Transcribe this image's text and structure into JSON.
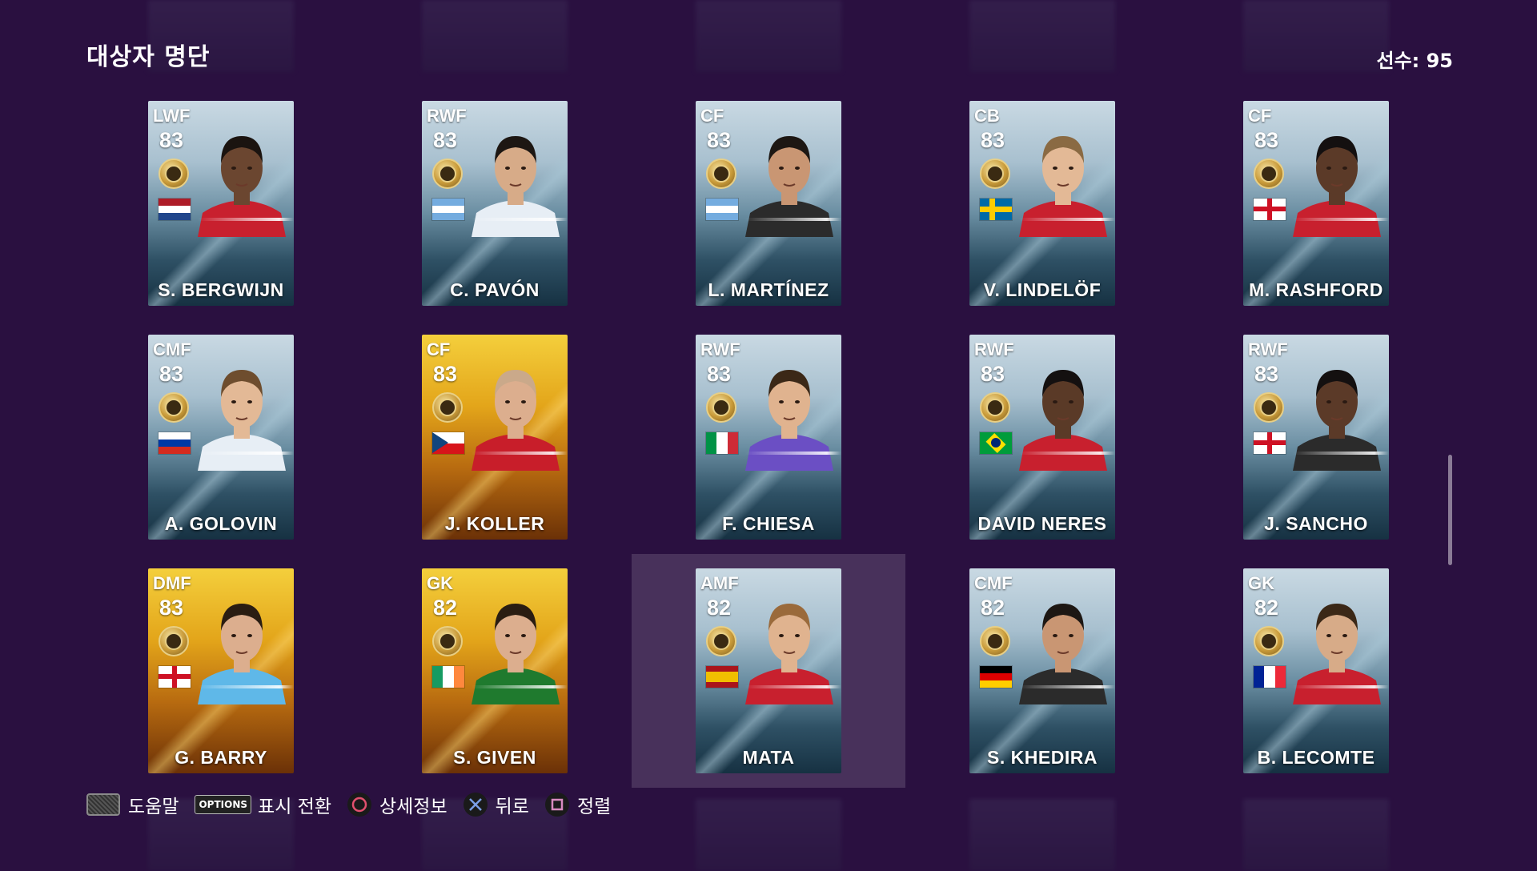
{
  "header": {
    "title": "대상자 명단",
    "player_count": "선수: 95"
  },
  "footer": [
    {
      "id": "help",
      "icon": "touchpad-icon",
      "label": "도움말"
    },
    {
      "id": "toggle",
      "icon": "options-icon",
      "button_text": "OPTIONS",
      "label": "표시 전환"
    },
    {
      "id": "detail",
      "icon": "circle-icon",
      "label": "상세정보"
    },
    {
      "id": "back",
      "icon": "cross-icon",
      "label": "뒤로"
    },
    {
      "id": "sort",
      "icon": "square-icon",
      "label": "정렬"
    }
  ],
  "cards": [
    {
      "position": "LWF",
      "rating": "83",
      "name": "S. BERGWIJN",
      "style": "normal",
      "nation": "netherlands",
      "jersey": "#c8202e",
      "hair": "#1b1410",
      "skin": "#6b4630"
    },
    {
      "position": "RWF",
      "rating": "83",
      "name": "C. PAVÓN",
      "style": "normal",
      "nation": "argentina",
      "jersey": "#e7eef5",
      "hair": "#1d1713",
      "skin": "#d7ab88"
    },
    {
      "position": "CF",
      "rating": "83",
      "name": "L. MARTÍNEZ",
      "style": "normal",
      "nation": "argentina",
      "jersey": "#2b2b2b",
      "hair": "#1d1713",
      "skin": "#c99673"
    },
    {
      "position": "CB",
      "rating": "83",
      "name": "V. LINDELÖF",
      "style": "normal",
      "nation": "sweden",
      "jersey": "#c8202e",
      "hair": "#8a6a43",
      "skin": "#e3b996"
    },
    {
      "position": "CF",
      "rating": "83",
      "name": "M. RASHFORD",
      "style": "normal",
      "nation": "england",
      "jersey": "#c8202e",
      "hair": "#141010",
      "skin": "#5b3a28"
    },
    {
      "position": "CMF",
      "rating": "83",
      "name": "A. GOLOVIN",
      "style": "normal",
      "nation": "russia",
      "jersey": "#e7eef5",
      "hair": "#6e4d2e",
      "skin": "#e3b996"
    },
    {
      "position": "CF",
      "rating": "83",
      "name": "J. KOLLER",
      "style": "legend",
      "nation": "czech",
      "jersey": "#c81e2a",
      "hair": "#caa98a",
      "skin": "#dcae8e"
    },
    {
      "position": "RWF",
      "rating": "83",
      "name": "F. CHIESA",
      "style": "normal",
      "nation": "italy",
      "jersey": "#6b4fc4",
      "hair": "#3b2817",
      "skin": "#e0b38f"
    },
    {
      "position": "RWF",
      "rating": "83",
      "name": "DAVID NERES",
      "style": "normal",
      "nation": "brazil",
      "jersey": "#c8202e",
      "hair": "#141010",
      "skin": "#5a3a27"
    },
    {
      "position": "RWF",
      "rating": "83",
      "name": "J. SANCHO",
      "style": "normal",
      "nation": "england",
      "jersey": "#2b2b2b",
      "hair": "#141010",
      "skin": "#5b3a28"
    },
    {
      "position": "DMF",
      "rating": "83",
      "name": "G. BARRY",
      "style": "legend",
      "nation": "england",
      "jersey": "#5fb8e8",
      "hair": "#2a1d12",
      "skin": "#dcae8e"
    },
    {
      "position": "GK",
      "rating": "82",
      "name": "S. GIVEN",
      "style": "legend",
      "nation": "ireland",
      "jersey": "#1f7a2e",
      "hair": "#2a1d12",
      "skin": "#dcae8e"
    },
    {
      "position": "AMF",
      "rating": "82",
      "name": "MATA",
      "style": "normal",
      "nation": "spain",
      "jersey": "#c8202e",
      "hair": "#9a6a3b",
      "skin": "#e0b38f",
      "selected": true
    },
    {
      "position": "CMF",
      "rating": "82",
      "name": "S. KHEDIRA",
      "style": "normal",
      "nation": "germany",
      "jersey": "#2b2b2b",
      "hair": "#1d1713",
      "skin": "#c99673"
    },
    {
      "position": "GK",
      "rating": "82",
      "name": "B. LECOMTE",
      "style": "normal",
      "nation": "france",
      "jersey": "#c8202e",
      "hair": "#3b2817",
      "skin": "#d7ab88"
    }
  ]
}
